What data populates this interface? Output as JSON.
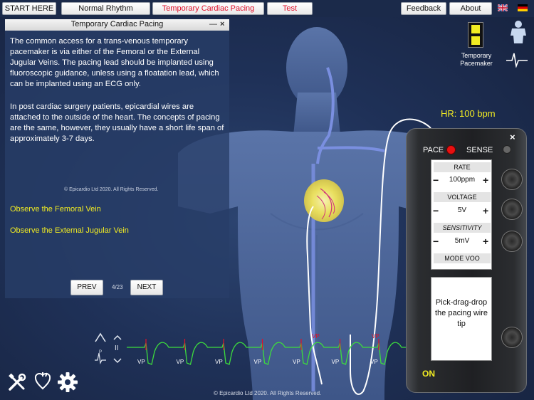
{
  "topbar": {
    "start": "START HERE",
    "normal": "Normal Rhythm",
    "temporary": "Temporary Cardiac Pacing",
    "test": "Test",
    "feedback": "Feedback",
    "about": "About"
  },
  "side_controls": {
    "temporary_pacemaker_label": "Temporary\nPacemaker"
  },
  "hr_label": "HR: 100 bpm",
  "panel": {
    "title": "Temporary Cardiac Pacing",
    "minimize": "—",
    "close": "×",
    "paragraph1": "The common access for a trans-venous temporary pacemaker is via either of the Femoral or the External Jugular Veins.  The pacing lead should be implanted using fluoroscopic guidance, unless using a floatation lead, which can be implanted using an ECG only.",
    "paragraph2": "In post cardiac surgery patients, epicardial wires are attached to the outside of the heart.  The concepts of pacing are the same, however, they usually have a short life span of approximately 3-7 days.",
    "copyright": "© Epicardio Ltd 2020. All Rights Reserved.",
    "observe1": "Observe the Femoral Vein",
    "observe2": "Observe the External Jugular Vein",
    "prev": "PREV",
    "page": "4/23",
    "next": "NEXT"
  },
  "device": {
    "close": "×",
    "pace": "PACE",
    "sense": "SENSE",
    "rate_head": "RATE",
    "rate_val": "100ppm",
    "voltage_head": "VOLTAGE",
    "voltage_val": "5V",
    "sensitivity_head": "SENSITIVITY",
    "sensitivity_val": "5mV",
    "mode": "MODE VOO",
    "instruction": "Pick-drag-drop the pacing wire tip",
    "on": "ON",
    "minus": "−",
    "plus": "+"
  },
  "ecg": {
    "beat_labels": [
      "VP",
      "VP",
      "VP",
      "VP",
      "VP",
      "VP",
      "VP"
    ],
    "mark_labels": [
      "VP",
      "VP"
    ],
    "lead_label": "II",
    "lead_tag": "P"
  },
  "footer_copyright": "© Epicardio Ltd 2020. All Rights Reserved.",
  "icons": {
    "tools": "tools-icon",
    "heart_hand": "heart-hand-icon",
    "settings": "gear-icon",
    "body": "body-icon",
    "ecg": "ecg-wave-icon"
  },
  "colors": {
    "accent_red": "#e0102a",
    "yellow": "#f2ec22",
    "ecg_green": "#3ddc3d",
    "pace_led": "#e81010"
  }
}
